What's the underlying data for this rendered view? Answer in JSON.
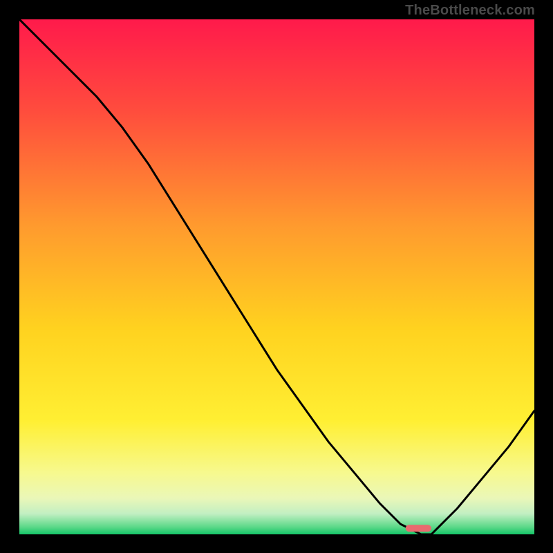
{
  "watermark": "TheBottleneck.com",
  "chart_data": {
    "type": "line",
    "title": "",
    "xlabel": "",
    "ylabel": "",
    "xlim": [
      0,
      100
    ],
    "ylim": [
      0,
      100
    ],
    "grid": false,
    "series": [
      {
        "name": "curve",
        "x": [
          0,
          5,
          10,
          15,
          20,
          25,
          30,
          35,
          40,
          45,
          50,
          55,
          60,
          65,
          70,
          74,
          78,
          80,
          85,
          90,
          95,
          100
        ],
        "y": [
          100,
          95,
          90,
          85,
          79,
          72,
          64,
          56,
          48,
          40,
          32,
          25,
          18,
          12,
          6,
          2,
          0,
          0,
          5,
          11,
          17,
          24
        ]
      }
    ],
    "marker": {
      "x_range": [
        75,
        80
      ],
      "y": 0.5
    },
    "gradient_stops": [
      {
        "offset": 0.0,
        "color": "#ff1a4b"
      },
      {
        "offset": 0.18,
        "color": "#ff4d3d"
      },
      {
        "offset": 0.4,
        "color": "#ff9a2e"
      },
      {
        "offset": 0.6,
        "color": "#ffd21f"
      },
      {
        "offset": 0.78,
        "color": "#ffef33"
      },
      {
        "offset": 0.88,
        "color": "#f7f98e"
      },
      {
        "offset": 0.93,
        "color": "#eaf7b8"
      },
      {
        "offset": 0.96,
        "color": "#c2efc2"
      },
      {
        "offset": 0.985,
        "color": "#5fd98a"
      },
      {
        "offset": 1.0,
        "color": "#15c668"
      }
    ]
  }
}
